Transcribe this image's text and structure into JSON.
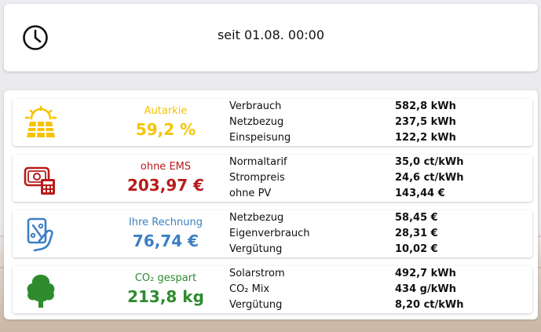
{
  "colors": {
    "yellow": "#f5c400",
    "red": "#b71c1c",
    "blue": "#3b7fc4",
    "green": "#2e8b2e"
  },
  "header": {
    "icon": "clock-icon",
    "text": "seit 01.08. 00:00"
  },
  "rows": [
    {
      "icon": "solar-panel-icon",
      "title": "Autarkie",
      "value": "59,2 %",
      "lines": [
        {
          "label": "Verbrauch",
          "value": "582,8 kWh"
        },
        {
          "label": "Netzbezug",
          "value": "237,5 kWh"
        },
        {
          "label": "Einspeisung",
          "value": "122,2 kWh"
        }
      ]
    },
    {
      "icon": "money-calculator-icon",
      "title": "ohne EMS",
      "value": "203,97 €",
      "lines": [
        {
          "label": "Normaltarif",
          "value": "35,0 ct/kWh"
        },
        {
          "label": "Strompreis",
          "value": "24,6 ct/kWh"
        },
        {
          "label": "ohne PV",
          "value": "143,44 €"
        }
      ]
    },
    {
      "icon": "bill-hand-icon",
      "title": "Ihre Rechnung",
      "value": "76,74 €",
      "lines": [
        {
          "label": "Netzbezug",
          "value": "58,45 €"
        },
        {
          "label": "Eigenverbrauch",
          "value": "28,31 €"
        },
        {
          "label": "Vergütung",
          "value": "10,02 €"
        }
      ]
    },
    {
      "icon": "tree-icon",
      "title": "CO₂ gespart",
      "value": "213,8 kg",
      "lines": [
        {
          "label": "Solarstrom",
          "value": "492,7 kWh"
        },
        {
          "label": "CO₂ Mix",
          "value": "434 g/kWh"
        },
        {
          "label": "Vergütung",
          "value": "8,20 ct/kWh"
        }
      ]
    }
  ]
}
